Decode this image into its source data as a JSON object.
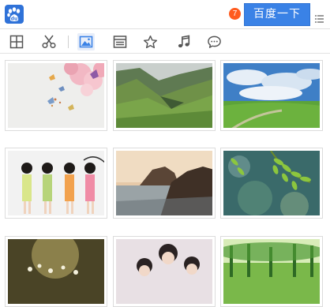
{
  "header": {
    "notification_count": "7",
    "search_button_label": "百度一下",
    "logo_icon": "baidu-paw-logo",
    "menu_icon": "dotted-menu-icon"
  },
  "toolbar": {
    "tools": [
      {
        "name": "grid-icon",
        "active": false
      },
      {
        "name": "scissors-icon",
        "active": false
      },
      {
        "name": "image-icon",
        "active": true
      },
      {
        "name": "layout-icon",
        "active": false
      },
      {
        "name": "star-icon",
        "active": false
      },
      {
        "name": "music-note-icon",
        "active": false
      },
      {
        "name": "chat-bubble-icon",
        "active": false
      }
    ]
  },
  "gallery": {
    "images": [
      {
        "subject": "butterflies-and-flowers"
      },
      {
        "subject": "green-mountain-valley"
      },
      {
        "subject": "grassland-blue-sky"
      },
      {
        "subject": "girls-in-dresses"
      },
      {
        "subject": "sea-cliff-sunset"
      },
      {
        "subject": "green-leaves-bokeh"
      },
      {
        "subject": "sunlit-flowers"
      },
      {
        "subject": "group-portrait"
      },
      {
        "subject": "green-forest"
      }
    ]
  },
  "colors": {
    "accent": "#3a82e6",
    "badge": "#ff5b1e",
    "icon": "#555555",
    "active_icon": "#3a82e6"
  }
}
